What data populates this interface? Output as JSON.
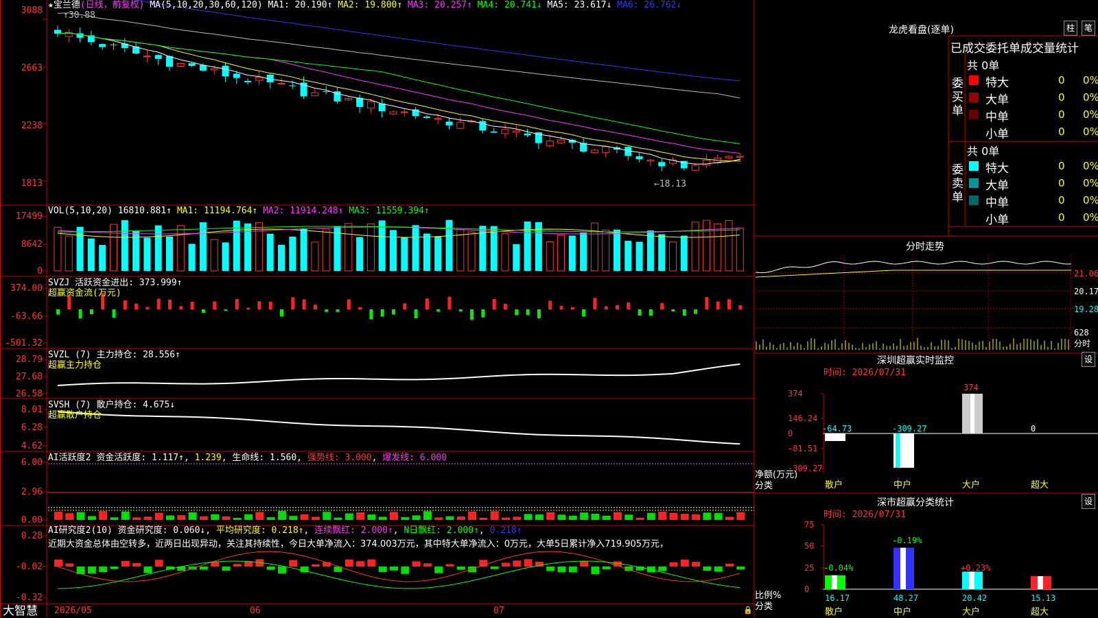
{
  "stock": {
    "star": "★",
    "name": "宝兰德",
    "period": "(日线，前复权)"
  },
  "main": {
    "ma_params": "MA(5,10,20,30,60,120)",
    "ma1": "MA1: 20.190↑",
    "ma2": "MA2: 19.800↑",
    "ma3": "MA3: 20.257↑",
    "ma4": "MA4: 20.741↓",
    "ma5": "MA5: 23.617↓",
    "ma6": "MA6: 26.762↓",
    "high_note": "↑30.88",
    "low_note": "←18.13",
    "yticks": [
      "3088",
      "2663",
      "2238",
      "1813"
    ]
  },
  "vol": {
    "label": "VOL(5,10,20)",
    "val": "16810.881↑",
    "ma1": "MA1: 11194.764↑",
    "ma2": "MA2: 11914.248↑",
    "ma3": "MA3: 11559.394↑",
    "yticks": [
      "17499",
      "8642",
      "0"
    ]
  },
  "svzj": {
    "label": "SVZJ  活跃资金进出: 373.999↑",
    "sub": "超赢资金流(万元)",
    "yticks": [
      "374.00",
      "-63.66",
      "-501.32"
    ]
  },
  "svzl": {
    "label": "SVZL (7) 主力持仓: 28.556↑",
    "sub": "超赢主力持仓",
    "yticks": [
      "28.79",
      "27.68",
      "26.58"
    ]
  },
  "svsh": {
    "label": "SVSH (7) 散户持仓: 4.675↓",
    "sub": "超赢散户持仓",
    "yticks": [
      "8.01",
      "6.28",
      "4.62"
    ]
  },
  "ai1": {
    "label": "AI活跃度2 资金活跃度: 1.117↑",
    "v2": "1.239",
    "v3": "生命线: 1.560",
    "v4": "强势线: 3.000",
    "v5": "爆发线: 6.000",
    "yticks": [
      "6.00",
      "2.96",
      "0.00"
    ]
  },
  "ai2": {
    "label": "AI研究度2(10) 资金研究度: 0.060↓",
    "v2": "平均研究度: 0.218↑",
    "v3": "连续飘红: 2.000↑",
    "v4": "N日飘红: 2.000↑",
    "v5": "0.218↑",
    "commentary": "近期大资金总体由空转多，近两日出现异动，关注其持续性，今日大单净流入：374.003万元，其中特大单净流入：0万元，大单5日累计净入719.905万元，",
    "yticks": [
      "0.28",
      "-0.02",
      "-0.32"
    ]
  },
  "xaxis": {
    "brand": "大智慧",
    "d1": "2026/05",
    "d2": "06",
    "d3": "07"
  },
  "right": {
    "title": "龙虎看盘(逐单)",
    "btn1": "柱",
    "btn2": "笔",
    "tabs": "已成交委托单成交量统计",
    "buy": {
      "label": "委买单",
      "total": "共 0单",
      "rows": [
        {
          "name": "特大",
          "v": "0",
          "p": "0%"
        },
        {
          "name": "大单",
          "v": "0",
          "p": "0%"
        },
        {
          "name": "中单",
          "v": "0",
          "p": "0%"
        },
        {
          "name": "小单",
          "v": "0",
          "p": "0%"
        }
      ]
    },
    "sell": {
      "label": "委卖单",
      "total": "共 0单",
      "rows": [
        {
          "name": "特大",
          "v": "0",
          "p": "0%"
        },
        {
          "name": "大单",
          "v": "0",
          "p": "0%"
        },
        {
          "name": "中单",
          "v": "0",
          "p": "0%"
        },
        {
          "name": "小单",
          "v": "0",
          "p": "0%"
        }
      ]
    },
    "colors": {
      "buy": [
        "#ff0000",
        "#990000",
        "#660000",
        "#000000"
      ],
      "sell": [
        "#00ffff",
        "#009999",
        "#006666",
        "#000000"
      ]
    }
  },
  "intraday": {
    "title": "分时走势",
    "p1": "21.06",
    "p2": "20.17",
    "p3": "19.28",
    "v": "628",
    "vl": "分时"
  },
  "monitor": {
    "title": "深圳超赢实时监控",
    "btn": "设",
    "time": "时间: 2026/07/31",
    "ylab": "净额(万元)",
    "cat": "分类",
    "yticks": [
      "374",
      "146.24",
      "0",
      "-81.51",
      "-309.27"
    ],
    "cats": [
      "散户",
      "中户",
      "大户",
      "超大"
    ],
    "vals": [
      "-64.73",
      "-309.27",
      "374",
      "0"
    ]
  },
  "classify": {
    "title": "深市超赢分类统计",
    "btn": "设",
    "time": "时间: 2026/07/31",
    "ylab": "比例%",
    "cat": "分类",
    "yticks": [
      "75",
      "50",
      "25",
      "0"
    ],
    "cats": [
      "散户",
      "中户",
      "大户",
      "超大"
    ],
    "vals": [
      "16.17",
      "48.27",
      "20.42",
      "15.13"
    ],
    "chg": [
      "-0.04%",
      "-0.19%",
      "+0.23%",
      ""
    ]
  }
}
